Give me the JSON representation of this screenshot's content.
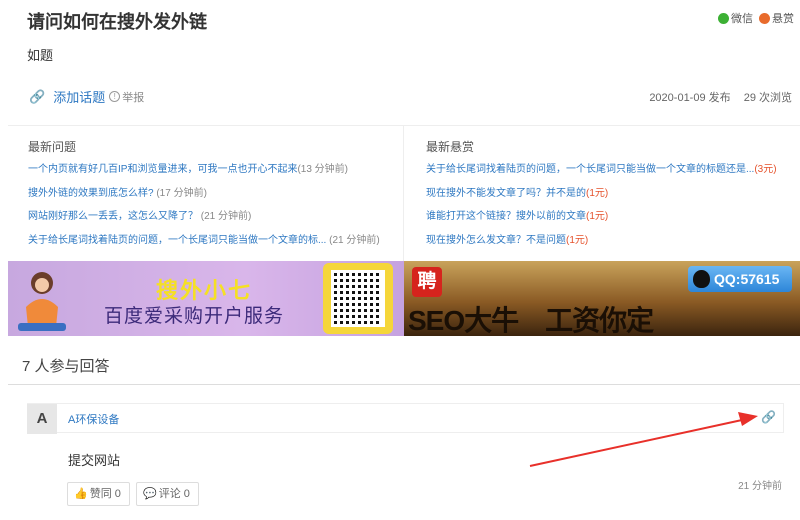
{
  "question": {
    "title": "请问如何在搜外发外链",
    "body": "如题",
    "add_topic": "添加话题",
    "report": "举报",
    "published": "2020-01-09 发布",
    "views": "29 次浏览"
  },
  "share": {
    "wechat": "微信",
    "reward": "悬赏"
  },
  "latest_questions": {
    "title": "最新问题",
    "items": [
      {
        "text": "一个内页就有好几百IP和浏览量进来，可我一点也开心不起来",
        "time": "(13 分钟前)"
      },
      {
        "text": "搜外外链的效果到底怎么样?",
        "time": "(17 分钟前)"
      },
      {
        "text": "网站刚好那么一丢丢，这怎么又降了？",
        "time": "(21 分钟前)"
      },
      {
        "text": "关于给长尾词找着陆页的问题，一个长尾词只能当做一个文章的标...",
        "time": "(21 分钟前)"
      }
    ]
  },
  "latest_rewards": {
    "title": "最新悬赏",
    "items": [
      {
        "text": "关于给长尾词找着陆页的问题，一个长尾词只能当做一个文章的标题还是...",
        "reward": "(3元)"
      },
      {
        "text": "现在搜外不能发文章了吗？并不是的",
        "reward": "(1元)"
      },
      {
        "text": "谁能打开这个链接？搜外以前的文章",
        "reward": "(1元)"
      },
      {
        "text": "现在搜外怎么发文章？不是问题",
        "reward": "(1元)"
      }
    ]
  },
  "banner_left": {
    "headline": "搜外小七",
    "subline": "百度爱采购开户服务"
  },
  "banner_right": {
    "badge": "聘",
    "headline": "SEO大牛　工资你定",
    "qq": "QQ:57615"
  },
  "answers": {
    "header": "7 人参与回答",
    "items": [
      {
        "avatar_letter": "A",
        "user": "A环保设备",
        "text": "提交网站",
        "like_label": "赞同 0",
        "comment_label": "评论 0",
        "time": "21 分钟前"
      }
    ]
  },
  "colors": {
    "link": "#2e78c2",
    "reward": "#e5522c",
    "arrow": "#e8302a"
  },
  "icons": [
    "link-icon",
    "info-icon",
    "wechat-icon",
    "reward-icon",
    "thumb-up-icon",
    "comment-icon"
  ]
}
